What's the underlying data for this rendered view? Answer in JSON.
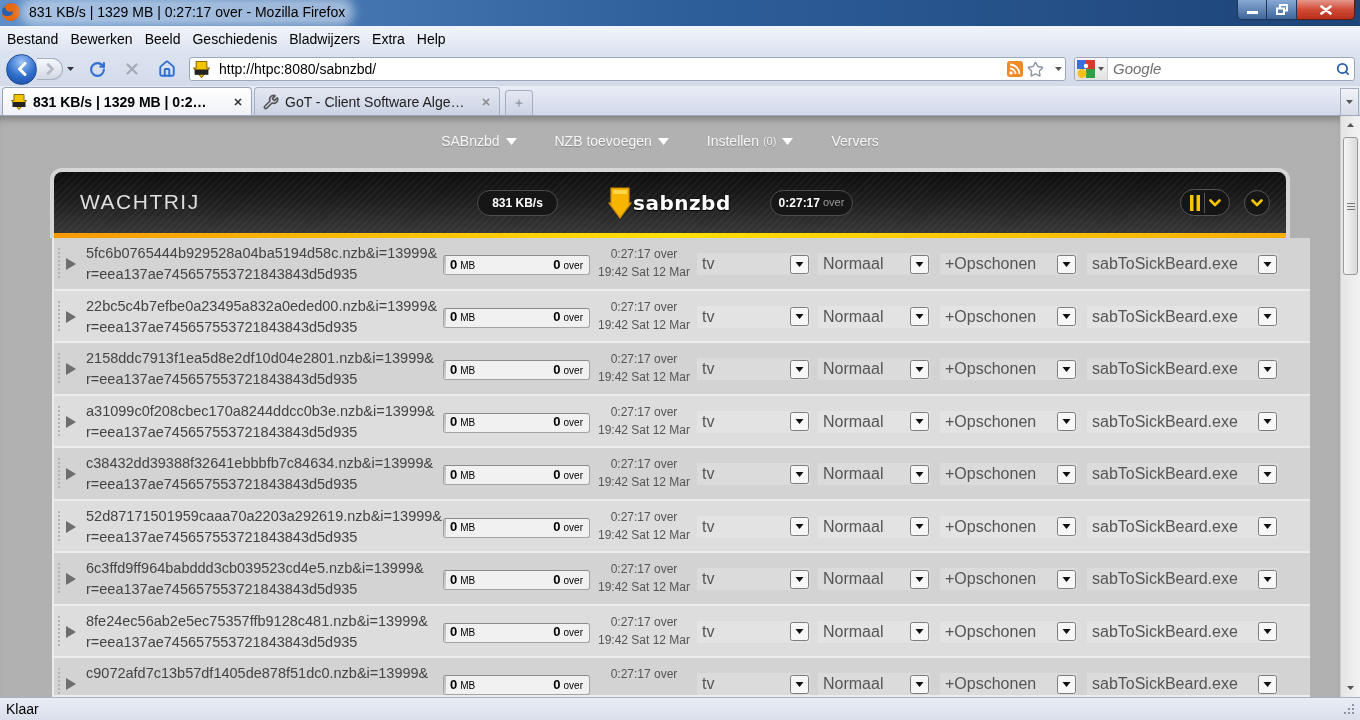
{
  "window": {
    "title": "831 KB/s | 1329 MB | 0:27:17 over - Mozilla Firefox"
  },
  "menu_bar": [
    "Bestand",
    "Bewerken",
    "Beeld",
    "Geschiedenis",
    "Bladwijzers",
    "Extra",
    "Help"
  ],
  "address_bar": {
    "url": "http://htpc:8080/sabnzbd/"
  },
  "search_bar": {
    "placeholder": "Google"
  },
  "tabs": [
    {
      "label": "831 KB/s | 1329 MB | 0:2…",
      "selected": true
    },
    {
      "label": "GoT - Client Software Alge…",
      "selected": false
    }
  ],
  "app_menu": [
    {
      "label": "SABnzbd",
      "dropdown": true
    },
    {
      "label": "NZB toevoegen",
      "dropdown": true
    },
    {
      "label": "Instellen",
      "count": "(0)",
      "dropdown": true
    },
    {
      "label": "Ververs",
      "dropdown": false
    }
  ],
  "queue_header": {
    "title": "WACHTRIJ",
    "speed": "831 KB/s",
    "logo": "sabnzbd",
    "time_left": "0:27:17",
    "time_left_suffix": "over"
  },
  "queue": [
    {
      "name_lines": [
        "5fc6b0765444b929528a04ba5194d58c.nzb&i=13999&",
        "r=eea137ae745657553721843843d5d935"
      ],
      "progress": {
        "level": 0,
        "downloaded": "0",
        "downloaded_unit": "MB",
        "remaining": "0",
        "remaining_unit": "over"
      },
      "time_left": "0:27:17 over",
      "eta": "19:42 Sat 12 Mar",
      "category": "tv",
      "priority": "Normaal",
      "processing": "+Opschonen",
      "script": "sabToSickBeard.exe"
    },
    {
      "name_lines": [
        "22bc5c4b7efbe0a23495a832a0eded00.nzb&i=13999&",
        "r=eea137ae745657553721843843d5d935"
      ],
      "progress": {
        "level": 0,
        "downloaded": "0",
        "downloaded_unit": "MB",
        "remaining": "0",
        "remaining_unit": "over"
      },
      "time_left": "0:27:17 over",
      "eta": "19:42 Sat 12 Mar",
      "category": "tv",
      "priority": "Normaal",
      "processing": "+Opschonen",
      "script": "sabToSickBeard.exe"
    },
    {
      "name_lines": [
        "2158ddc7913f1ea5d8e2df10d04e2801.nzb&i=13999&",
        "r=eea137ae745657553721843843d5d935"
      ],
      "progress": {
        "level": 0,
        "downloaded": "0",
        "downloaded_unit": "MB",
        "remaining": "0",
        "remaining_unit": "over"
      },
      "time_left": "0:27:17 over",
      "eta": "19:42 Sat 12 Mar",
      "category": "tv",
      "priority": "Normaal",
      "processing": "+Opschonen",
      "script": "sabToSickBeard.exe"
    },
    {
      "name_lines": [
        "a31099c0f208cbec170a8244ddcc0b3e.nzb&i=13999&",
        "r=eea137ae745657553721843843d5d935"
      ],
      "progress": {
        "level": 0,
        "downloaded": "0",
        "downloaded_unit": "MB",
        "remaining": "0",
        "remaining_unit": "over"
      },
      "time_left": "0:27:17 over",
      "eta": "19:42 Sat 12 Mar",
      "category": "tv",
      "priority": "Normaal",
      "processing": "+Opschonen",
      "script": "sabToSickBeard.exe"
    },
    {
      "name_lines": [
        "c38432dd39388f32641ebbbfb7c84634.nzb&i=13999&",
        "r=eea137ae745657553721843843d5d935"
      ],
      "progress": {
        "level": 0,
        "downloaded": "0",
        "downloaded_unit": "MB",
        "remaining": "0",
        "remaining_unit": "over"
      },
      "time_left": "0:27:17 over",
      "eta": "19:42 Sat 12 Mar",
      "category": "tv",
      "priority": "Normaal",
      "processing": "+Opschonen",
      "script": "sabToSickBeard.exe"
    },
    {
      "name_lines": [
        "52d87171501959caaa70a2203a292619.nzb&i=13999&",
        "r=eea137ae745657553721843843d5d935"
      ],
      "progress": {
        "level": 0,
        "downloaded": "0",
        "downloaded_unit": "MB",
        "remaining": "0",
        "remaining_unit": "over"
      },
      "time_left": "0:27:17 over",
      "eta": "19:42 Sat 12 Mar",
      "category": "tv",
      "priority": "Normaal",
      "processing": "+Opschonen",
      "script": "sabToSickBeard.exe"
    },
    {
      "name_lines": [
        "6c3ffd9ff964babddd3cb039523cd4e5.nzb&i=13999&",
        "r=eea137ae745657553721843843d5d935"
      ],
      "progress": {
        "level": 0,
        "downloaded": "0",
        "downloaded_unit": "MB",
        "remaining": "0",
        "remaining_unit": "over"
      },
      "time_left": "0:27:17 over",
      "eta": "19:42 Sat 12 Mar",
      "category": "tv",
      "priority": "Normaal",
      "processing": "+Opschonen",
      "script": "sabToSickBeard.exe"
    },
    {
      "name_lines": [
        "8fe24ec56ab2e5ec75357ffb9128c481.nzb&i=13999&",
        "r=eea137ae745657553721843843d5d935"
      ],
      "progress": {
        "level": 0,
        "downloaded": "0",
        "downloaded_unit": "MB",
        "remaining": "0",
        "remaining_unit": "over"
      },
      "time_left": "0:27:17 over",
      "eta": "19:42 Sat 12 Mar",
      "category": "tv",
      "priority": "Normaal",
      "processing": "+Opschonen",
      "script": "sabToSickBeard.exe"
    },
    {
      "name_lines": [
        "c9072afd7c13b57df1405de878f51dc0.nzb&i=13999&"
      ],
      "progress": {
        "level": 0,
        "downloaded": "0",
        "downloaded_unit": "MB",
        "remaining": "0",
        "remaining_unit": "over"
      },
      "time_left": "0:27:17 over",
      "category": "tv",
      "priority": "Normaal",
      "processing": "+Opschonen",
      "script": "sabToSickBeard.exe"
    }
  ],
  "status_bar": {
    "text": "Klaar"
  }
}
